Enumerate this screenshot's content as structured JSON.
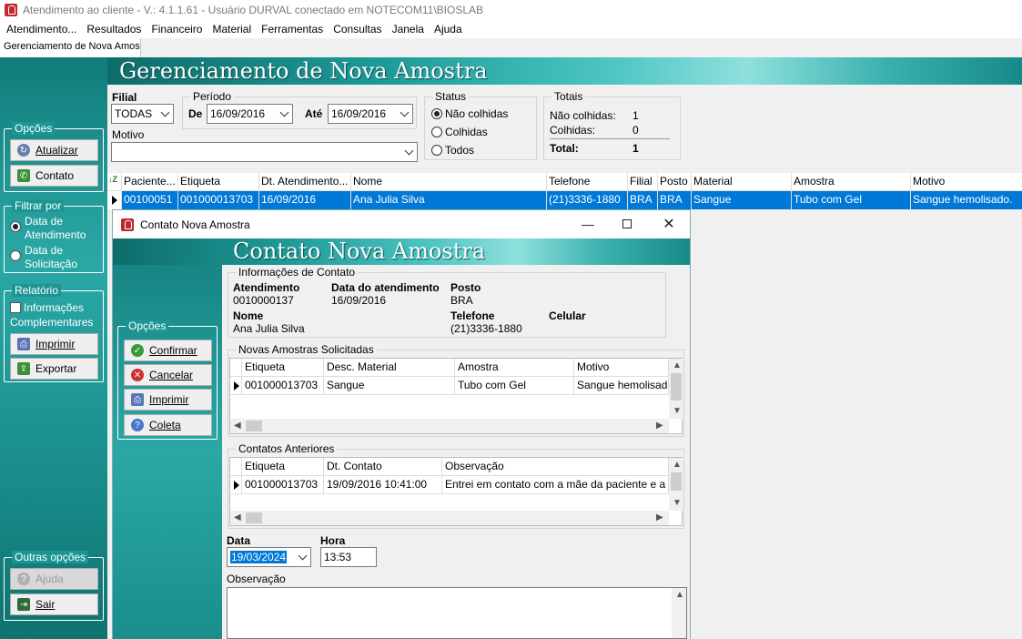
{
  "window": {
    "title": "Atendimento ao cliente - V.: 4.1.1.61 - Usuário DURVAL conectado em NOTECOM11\\BIOSLAB"
  },
  "menu": [
    "Atendimento...",
    "Resultados",
    "Financeiro",
    "Material",
    "Ferramentas",
    "Consultas",
    "Janela",
    "Ajuda"
  ],
  "tab": "Gerenciamento de Nova Amostra",
  "banner_title": "Gerenciamento de Nova Amostra",
  "left": {
    "opcoes_legend": "Opções",
    "atualizar": "Atualizar",
    "contato": "Contato",
    "filtrar_legend": "Filtrar por",
    "filtro_atendimento": "Data de Atendimento",
    "filtro_solicitacao": "Data de Solicitação",
    "relatorio_legend": "Relatório",
    "info_complementares": "Informações Complementares",
    "imprimir": "Imprimir",
    "exportar": "Exportar",
    "outras_legend": "Outras opções",
    "ajuda": "Ajuda",
    "sair": "Sair"
  },
  "filters": {
    "filial_label": "Filial",
    "filial_value": "TODAS",
    "periodo_legend": "Período",
    "de_label": "De",
    "de_value": "16/09/2016",
    "ate_label": "Até",
    "ate_value": "16/09/2016",
    "motivo_label": "Motivo",
    "motivo_value": "",
    "status_legend": "Status",
    "status_options": [
      "Não colhidas",
      "Colhidas",
      "Todos"
    ],
    "totais_legend": "Totais",
    "nao_colhidas_label": "Não colhidas:",
    "nao_colhidas_value": "1",
    "colhidas_label": "Colhidas:",
    "colhidas_value": "0",
    "total_label": "Total:",
    "total_value": "1"
  },
  "grid": {
    "headers": [
      "Paciente...",
      "Etiqueta",
      "Dt. Atendimento...",
      "Nome",
      "Telefone",
      "Filial",
      "Posto",
      "Material",
      "Amostra",
      "Motivo"
    ],
    "row": [
      "00100051",
      "001000013703",
      "16/09/2016",
      "Ana Julia Silva",
      "(21)3336-1880",
      "BRA",
      "BRA",
      "Sangue",
      "Tubo com Gel",
      "Sangue hemolisado."
    ]
  },
  "modal": {
    "title": "Contato Nova Amostra",
    "banner_title": "Contato Nova Amostra",
    "opcoes_legend": "Opções",
    "confirmar": "Confirmar",
    "cancelar": "Cancelar",
    "imprimir": "Imprimir",
    "coleta": "Coleta",
    "info_legend": "Informações de Contato",
    "atendimento_label": "Atendimento",
    "atendimento_value": "0010000137",
    "data_atend_label": "Data do atendimento",
    "data_atend_value": "16/09/2016",
    "posto_label": "Posto",
    "posto_value": "BRA",
    "nome_label": "Nome",
    "nome_value": "Ana Julia Silva",
    "telefone_label": "Telefone",
    "telefone_value": "(21)3336-1880",
    "celular_label": "Celular",
    "celular_value": "",
    "novas_legend": "Novas Amostras Solicitadas",
    "novas_headers": [
      "Etiqueta",
      "Desc. Material",
      "Amostra",
      "Motivo"
    ],
    "novas_row": [
      "001000013703",
      "Sangue",
      "Tubo com Gel",
      "Sangue hemolisado."
    ],
    "anteriores_legend": "Contatos Anteriores",
    "anteriores_headers": [
      "Etiqueta",
      "Dt. Contato",
      "Observação"
    ],
    "anteriores_row": [
      "001000013703",
      "19/09/2016 10:41:00",
      "Entrei em contato com a mãe da paciente e a"
    ],
    "data_label": "Data",
    "data_value": "19/03/2024",
    "hora_label": "Hora",
    "hora_value": "13:53",
    "obs_label": "Observação",
    "obs_value": ""
  }
}
